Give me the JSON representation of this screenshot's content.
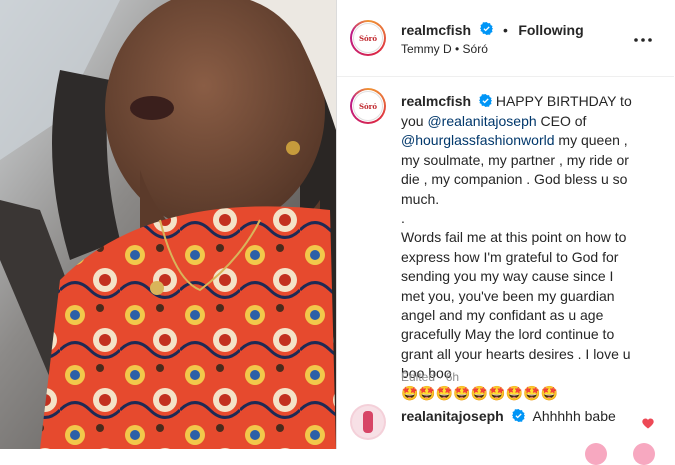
{
  "post": {
    "username": "realmcfish",
    "follow_status": "Following",
    "separator": "•",
    "subtitle": "Temmy D • Sóró",
    "more_icon": "more-horizontal-icon",
    "avatar_logo_text": "Sóró"
  },
  "caption": {
    "username": "realmcfish",
    "text_1": "HAPPY BIRTHDAY to you",
    "mention_1": "@realanitajoseph",
    "text_2": "CEO of",
    "mention_2": "@hourglassfashionworld",
    "text_3": "my queen , my soulmate, my partner , my ride or die , my companion . God bless u so much.",
    "dot_line": ".",
    "text_4": "Words fail me at this point on how to express how I'm grateful to God for sending you my way cause since I met you, you've been my guardian angel and my confidant as u age gracefully May the lord continue to grant all your hearts desires . I love u boo boo",
    "emojis": "🤩🤩🤩🤩🤩🤩🤩🤩🤩",
    "edited": "Edited · 6h"
  },
  "comment": {
    "username": "realanitajoseph",
    "text": "Ahhhhh babe"
  },
  "colors": {
    "verified": "#0095f6",
    "link": "#00376b",
    "heart": "#ed4956"
  }
}
